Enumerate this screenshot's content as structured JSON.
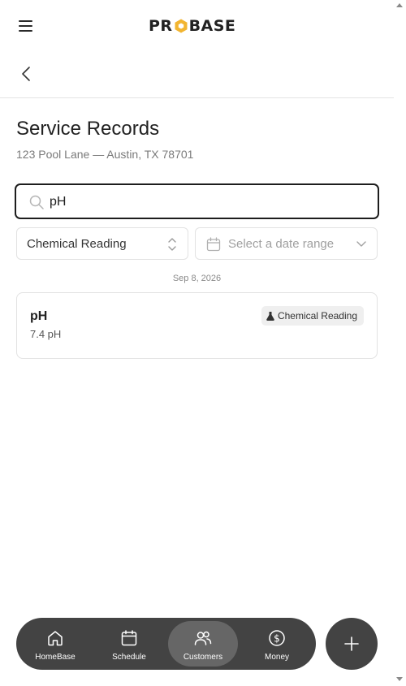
{
  "header": {
    "logo_text": "PROBASE",
    "brand_accent": "#f2b531"
  },
  "page": {
    "title": "Service Records",
    "address": "123 Pool Lane — Austin, TX 78701"
  },
  "filters": {
    "search_value": "pH",
    "search_placeholder": "Search",
    "type_selected": "Chemical Reading",
    "date_placeholder": "Select a date range"
  },
  "records": {
    "date_label": "Sep 8, 2026",
    "items": [
      {
        "name": "pH",
        "value": "7.4 pH",
        "badge": "Chemical Reading",
        "badge_icon": "flask-icon"
      }
    ]
  },
  "nav": {
    "items": [
      {
        "label": "HomeBase",
        "icon": "home-icon"
      },
      {
        "label": "Schedule",
        "icon": "calendar-icon"
      },
      {
        "label": "Customers",
        "icon": "users-icon",
        "active": true
      },
      {
        "label": "Money",
        "icon": "dollar-circle-icon"
      }
    ],
    "fab_icon": "plus-icon"
  },
  "colors": {
    "nav_bg": "#434343",
    "nav_active": "#666666",
    "border": "#e2e2e2",
    "text_muted": "#7a7a7a"
  }
}
